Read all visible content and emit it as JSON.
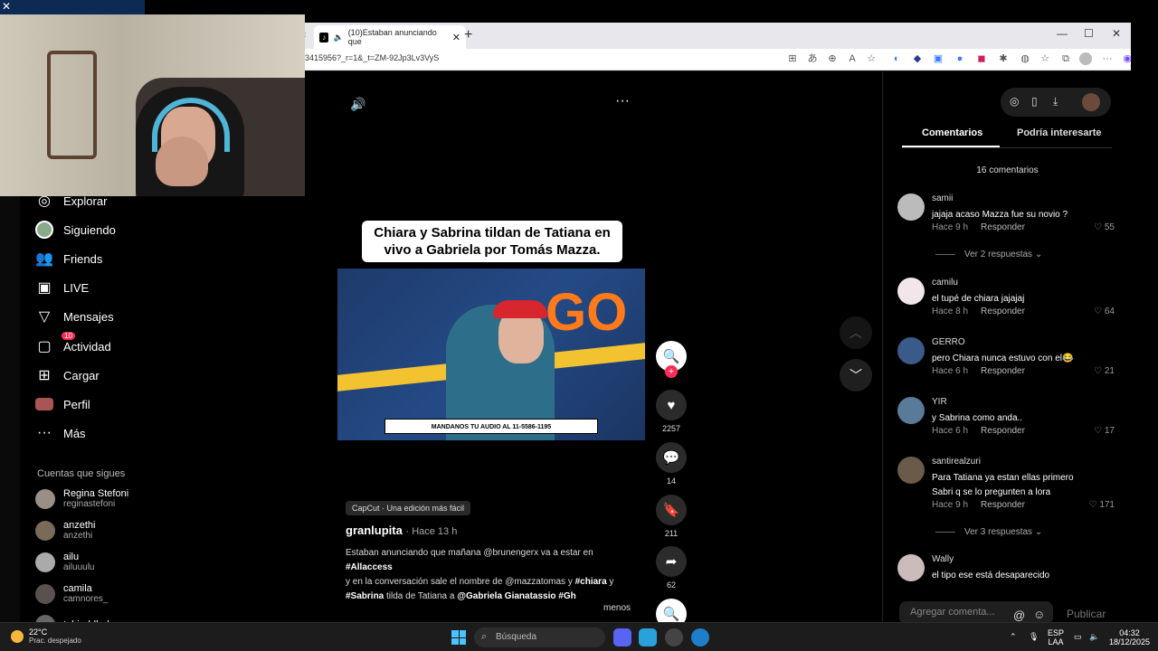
{
  "browser": {
    "tab_title": "(10)Estaban anunciando que",
    "url": "3415956?_r=1&_t=ZM-92Jp3Lv3VyS",
    "window_controls": [
      "—",
      "☐",
      "✕"
    ]
  },
  "sidebar": {
    "items": [
      {
        "label": "Explorar",
        "icon": "compass-icon"
      },
      {
        "label": "Siguiendo",
        "icon": "avatar-icon"
      },
      {
        "label": "Friends",
        "icon": "friends-icon"
      },
      {
        "label": "LIVE",
        "icon": "live-icon"
      },
      {
        "label": "Mensajes",
        "icon": "send-icon"
      },
      {
        "label": "Actividad",
        "icon": "activity-icon",
        "badge": "10"
      },
      {
        "label": "Cargar",
        "icon": "upload-icon"
      },
      {
        "label": "Perfil",
        "icon": "profile-icon"
      },
      {
        "label": "Más",
        "icon": "more-icon"
      }
    ],
    "following_title": "Cuentas que sigues",
    "following": [
      {
        "name": "Regina Stefoni",
        "handle": "reginastefoni"
      },
      {
        "name": "anzethi",
        "handle": "anzethi"
      },
      {
        "name": "ailu",
        "handle": "ailuuulu"
      },
      {
        "name": "camila",
        "handle": "camnores_"
      },
      {
        "name": "tobiroblledo",
        "handle": ""
      }
    ]
  },
  "video": {
    "title": "Chiara y Sabrina tildan de Tatiana en vivo a Gabriela por Tomás Mazza.",
    "banner": "MANDANOS TU AUDIO AL 11-5586-1195",
    "logo_text": "GO",
    "capcut": "CapCut · Una edición más fácil",
    "author": "granlupita",
    "time": "· Hace 13 h",
    "desc_line1": "Estaban anunciando que mañana @brunengerx va a estar en",
    "desc_tag1": "#Allaccess",
    "desc_line2": " y en la conversación sale el nombre de @mazzatomas y ",
    "desc_tag2": "#chiara",
    "desc_line2b": " y",
    "desc_tag3": "#Sabrina",
    "desc_line3": " tilda de Tatiana a ",
    "desc_tag4": "@Gabriela Gianatassio #Gh",
    "menos": "menos",
    "likes": "2257",
    "comments": "14",
    "saves": "211",
    "shares": "62"
  },
  "comments_panel": {
    "tab_comments": "Comentarios",
    "tab_interest": "Podría interesarte",
    "count": "16 comentarios",
    "comments": [
      {
        "user": "samii",
        "text": "jajaja acaso Mazza fue su novio ?",
        "time": "Hace 9 h",
        "likes": "55"
      },
      {
        "user": "camilu",
        "text": "el tupé de chiara jajajaj",
        "time": "Hace 8 h",
        "likes": "64"
      },
      {
        "user": "GERRO",
        "text": "pero Chiara nunca estuvo con el😂",
        "time": "Hace 6 h",
        "likes": "21"
      },
      {
        "user": "YIR",
        "text": "y Sabrina como anda..",
        "time": "Hace 6 h",
        "likes": "17"
      },
      {
        "user": "santirealzuri",
        "text": "Para Tatiana ya estan ellas primero Sabri q se lo pregunten a lora",
        "time": "Hace 9 h",
        "likes": "171"
      },
      {
        "user": "Wally",
        "text": "el tipo ese está desaparecido",
        "time": "",
        "likes": ""
      }
    ],
    "reply_label": "Responder",
    "more_replies_1": "Ver 2 respuestas",
    "more_replies_2": "Ver 3 respuestas",
    "add_placeholder": "Agregar comenta...",
    "publish": "Publicar"
  },
  "taskbar": {
    "temp": "22°C",
    "weather": "Prac. despejado",
    "search": "Búsqueda",
    "lang1": "ESP",
    "lang2": "LAA",
    "time": "04:32",
    "date": "18/12/2025"
  }
}
